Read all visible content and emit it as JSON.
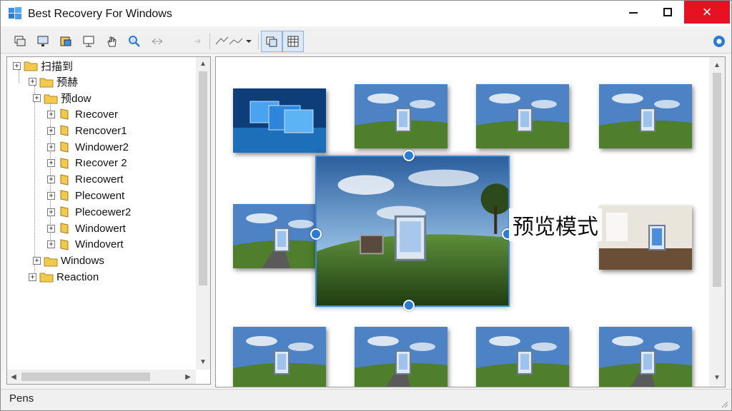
{
  "window": {
    "title": "Best Recovery For Windows",
    "close_glyph": "×"
  },
  "toolbar": {
    "icons": [
      "copy-icon",
      "monitor-icon",
      "drive-icon",
      "display-icon",
      "hand-icon",
      "search-icon",
      "back-forward-icon",
      "arrow-icon",
      "filter-icon",
      "view-icon",
      "grid-icon",
      "settings-icon"
    ]
  },
  "tree": {
    "items": [
      {
        "label": "扫描到",
        "level": 0
      },
      {
        "label": "预赫",
        "level": 1
      },
      {
        "label": "预dow",
        "level": 2
      },
      {
        "label": "Rıecover",
        "level": 3
      },
      {
        "label": "Rencover1",
        "level": 3
      },
      {
        "label": "Windower2",
        "level": 3
      },
      {
        "label": "Rıecover 2",
        "level": 3
      },
      {
        "label": "Rıecowert",
        "level": 3
      },
      {
        "label": "Plecowent",
        "level": 3
      },
      {
        "label": "Plecoewer2",
        "level": 3
      },
      {
        "label": "Windowert",
        "level": 3
      },
      {
        "label": "Windovert",
        "level": 3
      },
      {
        "label": "Windows",
        "level": 2
      },
      {
        "label": "Reaction",
        "level": 1
      }
    ]
  },
  "preview": {
    "mode_label": "预览模式"
  },
  "status": {
    "text": "Pens"
  },
  "colors": {
    "accent": "#2c7bd2",
    "close": "#e81123",
    "folder": "#f2c94c"
  }
}
